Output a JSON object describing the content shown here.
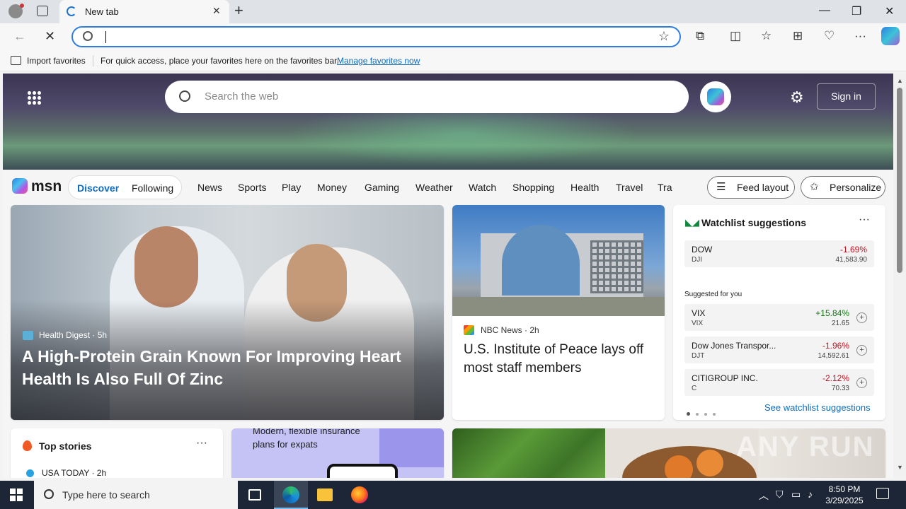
{
  "browser": {
    "tab": {
      "title": "New tab",
      "close": "✕"
    },
    "new_tab": "+",
    "window": {
      "minimize": "—",
      "restore": "❐",
      "close": "✕"
    },
    "address": {
      "value": "",
      "placeholder": ""
    },
    "favorites_bar": {
      "import_label": "Import favorites",
      "hint": "For quick access, place your favorites here on the favorites bar.",
      "link": "Manage favorites now"
    }
  },
  "msn": {
    "search_placeholder": "Search the web",
    "sign_in": "Sign in",
    "logo": "msn",
    "pill": {
      "discover": "Discover",
      "following": "Following"
    },
    "nav_items": [
      "News",
      "Sports",
      "Play",
      "Money",
      "Gaming",
      "Weather",
      "Watch",
      "Shopping",
      "Health",
      "Travel",
      "Tra"
    ],
    "feed_layout": "Feed layout",
    "personalize": "Personalize"
  },
  "hero": {
    "source": "Health Digest · 5h",
    "title": "A High-Protein Grain Known For Improving Heart Health Is Also Full Of Zinc"
  },
  "news": {
    "source": "NBC News · 2h",
    "title": "U.S. Institute of Peace lays off most staff members"
  },
  "watchlist": {
    "title": "Watchlist suggestions",
    "more": "···",
    "main": {
      "name": "DOW",
      "symbol": "DJI",
      "change": "-1.69%",
      "price": "41,583.90"
    },
    "suggested_label": "Suggested for you",
    "suggested": [
      {
        "name": "VIX",
        "symbol": "VIX",
        "change": "+15.84%",
        "price": "21.65",
        "dir": "pos"
      },
      {
        "name": "Dow Jones Transpor...",
        "symbol": "DJT",
        "change": "-1.96%",
        "price": "14,592.61",
        "dir": "neg"
      },
      {
        "name": "CITIGROUP INC.",
        "symbol": "C",
        "change": "-2.12%",
        "price": "70.33",
        "dir": "neg"
      }
    ],
    "link": "See watchlist suggestions"
  },
  "top_stories": {
    "title": "Top stories",
    "more": "···",
    "source": "USA TODAY · 2h"
  },
  "ad": {
    "text": "Modern, flexible insurance plans for expats"
  },
  "watermark": "ANY RUN",
  "taskbar": {
    "search_placeholder": "Type here to search",
    "time": "8:50 PM",
    "date": "3/29/2025"
  }
}
